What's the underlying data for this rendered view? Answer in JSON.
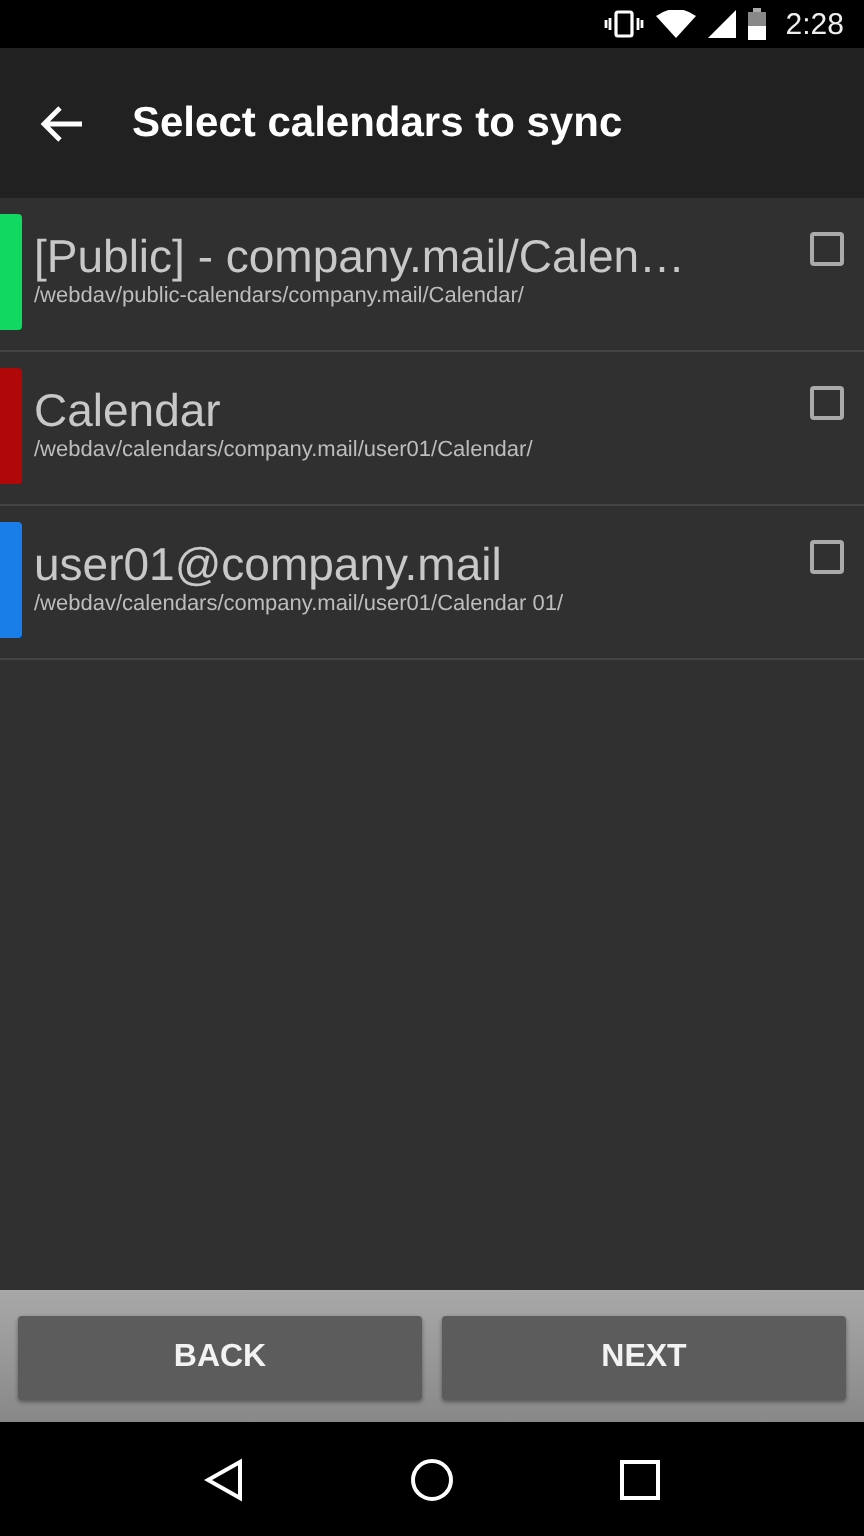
{
  "status_bar": {
    "time": "2:28"
  },
  "app_bar": {
    "title": "Select calendars to sync"
  },
  "calendars": [
    {
      "name": "[Public] - company.mail/Calen…",
      "path": "/webdav/public-calendars/company.mail/Calendar/",
      "color": "#10d860",
      "checked": false
    },
    {
      "name": "Calendar",
      "path": "/webdav/calendars/company.mail/user01/Calendar/",
      "color": "#b00808",
      "checked": false
    },
    {
      "name": "user01@company.mail",
      "path": "/webdav/calendars/company.mail/user01/Calendar 01/",
      "color": "#1a7ee8",
      "checked": false
    }
  ],
  "buttons": [
    {
      "label": "BACK"
    },
    {
      "label": "NEXT"
    }
  ]
}
